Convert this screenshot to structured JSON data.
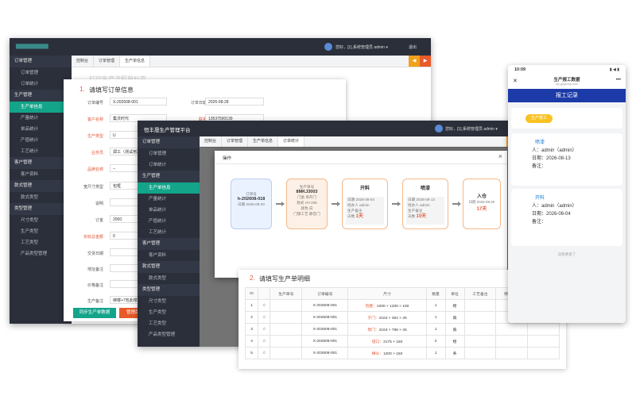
{
  "win1": {
    "logo_blur": "▇▇▇▇▇▇▇▇▇▇▇",
    "greeting": "您好，[1],系统管理员 admin ▾",
    "logout": "退出",
    "tabs": [
      "控制台",
      "订单管理",
      "生产单信息"
    ],
    "faded_title": "打印生产流程单标签",
    "sidebar": [
      {
        "type": "grp",
        "label": "订单管理"
      },
      {
        "type": "itm",
        "label": "订单管理"
      },
      {
        "type": "itm",
        "label": "订单统计"
      },
      {
        "type": "grp",
        "label": "生产管理"
      },
      {
        "type": "itm",
        "label": "生产单信息",
        "active": true
      },
      {
        "type": "itm",
        "label": "产量统计"
      },
      {
        "type": "itm",
        "label": "单品统计"
      },
      {
        "type": "itm",
        "label": "产值统计"
      },
      {
        "type": "itm",
        "label": "工艺统计"
      },
      {
        "type": "grp",
        "label": "客户管理"
      },
      {
        "type": "itm",
        "label": "客户资料"
      },
      {
        "type": "grp",
        "label": "款式管理"
      },
      {
        "type": "itm",
        "label": "款式类型"
      },
      {
        "type": "grp",
        "label": "类型管理"
      },
      {
        "type": "itm",
        "label": "尺寸类型"
      },
      {
        "type": "itm",
        "label": "生产类型"
      },
      {
        "type": "itm",
        "label": "工艺类型"
      },
      {
        "type": "itm",
        "label": "产品类型管理"
      }
    ]
  },
  "form": {
    "section_num": "1.",
    "section_title": "请填写订单信息",
    "order_no_label": "订单编号",
    "order_no": "X-202608-001",
    "order_date_label": "订单日期",
    "order_date": "2026-08-28",
    "customer_label": "客户名称",
    "customer": "集沃时代",
    "contact_label": "联系电话",
    "contact": "13537590139",
    "ptype_label": "生产类型",
    "ptype": "U",
    "sales_label": "业务员",
    "sales": "郑工（测试用）",
    "brand_label": "品牌名称",
    "brand": "--",
    "size_label": "宽尺寸类型",
    "size": "包框",
    "desc_label": "说明",
    "deposit_label": "订金",
    "deposit": "2000",
    "paid_label": "实收总金额",
    "paid": "0",
    "delivery_label": "交货日期",
    "addr_label": "地址备注",
    "price_label": "价格备注",
    "pnote_label": "生产备注",
    "pnote": "绑楼+7包此楼",
    "btn_sync": "同步生产单数据",
    "btn_manage": "管理后台"
  },
  "win2": {
    "title": "恒丰晟生产管理平台",
    "greeting": "您好，[1],系统管理员 admin ▾",
    "logout": "退出",
    "tabs": [
      "控制台",
      "订单管理",
      "生产单信息",
      "订单统计"
    ],
    "sidebar": [
      {
        "type": "grp",
        "label": "订单管理"
      },
      {
        "type": "itm",
        "label": "订单管理"
      },
      {
        "type": "itm",
        "label": "订单统计"
      },
      {
        "type": "grp",
        "label": "生产管理"
      },
      {
        "type": "itm",
        "label": "生产单信息",
        "active": true
      },
      {
        "type": "itm",
        "label": "产量统计"
      },
      {
        "type": "itm",
        "label": "单品统计"
      },
      {
        "type": "itm",
        "label": "产值统计"
      },
      {
        "type": "itm",
        "label": "工艺统计"
      },
      {
        "type": "grp",
        "label": "客户管理"
      },
      {
        "type": "itm",
        "label": "客户资料"
      },
      {
        "type": "grp",
        "label": "款式管理"
      },
      {
        "type": "itm",
        "label": "款式类型"
      },
      {
        "type": "grp",
        "label": "类型管理"
      },
      {
        "type": "itm",
        "label": "尺寸类型"
      },
      {
        "type": "itm",
        "label": "生产类型"
      },
      {
        "type": "itm",
        "label": "工艺类型"
      },
      {
        "type": "itm",
        "label": "产品类型管理"
      }
    ]
  },
  "modal": {
    "title": "操作",
    "close": "×",
    "card1": {
      "l1": "订单号",
      "l2": "h-202608-018",
      "l3": "日期 2026-08-03"
    },
    "card2": {
      "l1": "生产单号",
      "l2": "8MKJ3003",
      "l3": "门类 单开门",
      "l4": "款式 HY-205",
      "l5": "颜色 白",
      "l6": "门锁工艺 静音门"
    },
    "steps": [
      {
        "title": "开料",
        "date": "日期 2026-08-04",
        "op": "经办人 admin",
        "sub": "生产备注",
        "days_label": "天数",
        "days": "1天"
      },
      {
        "title": "喷漆",
        "date": "日期 2026-08-13",
        "op": "经办人 admin",
        "sub": "生产备注",
        "days_label": "天数",
        "days": "10天"
      },
      {
        "title": "入仓",
        "date": "日期 2026-08-20",
        "days": "17天"
      }
    ]
  },
  "detail": {
    "num": "2.",
    "title": "请填写生产单明细",
    "headers": [
      "ID",
      "",
      "生产单号",
      "订单编号",
      "尺寸",
      "数量",
      "单位",
      "工艺备注",
      "特殊工艺",
      "生产备注"
    ],
    "rows": [
      {
        "id": "1",
        "star": "☆",
        "order": "X-202608-001",
        "part": "包框：",
        "size": "2200 × 1200 × 150",
        "qty": "1",
        "unit": "樘"
      },
      {
        "id": "2",
        "star": "☆",
        "order": "X-202608-001",
        "part": "子门：",
        "size": "2163 × 354 × 45",
        "qty": "1",
        "unit": "扇"
      },
      {
        "id": "3",
        "star": "☆",
        "order": "X-202608-001",
        "part": "母门：",
        "size": "2163 × 798 × 45",
        "qty": "1",
        "unit": "扇"
      },
      {
        "id": "4",
        "star": "☆",
        "order": "X-202608-001",
        "part": "垭口：",
        "size": "2175 × 150",
        "qty": "2",
        "unit": "樘"
      },
      {
        "id": "5",
        "star": "☆",
        "order": "X-202608-001",
        "part": "横头：",
        "size": "1200 × 150",
        "qty": "1",
        "unit": "条"
      }
    ]
  },
  "phone": {
    "time": "10:09",
    "status_icons": "▮ ◀ ▮",
    "title": "生产报工数据",
    "url": "hjc.gzgshop.com",
    "more": "•••",
    "banner": "报工记录",
    "pill": "生产报工",
    "entries": [
      {
        "step": "喷漆",
        "person": "人：admin（admin）",
        "date": "日期：2026-08-13",
        "note": "备注："
      },
      {
        "step": "开料",
        "person": "人：admin（admin）",
        "date": "日期：2026-08-04",
        "note": "备注："
      }
    ],
    "footer": "没有更多了"
  }
}
